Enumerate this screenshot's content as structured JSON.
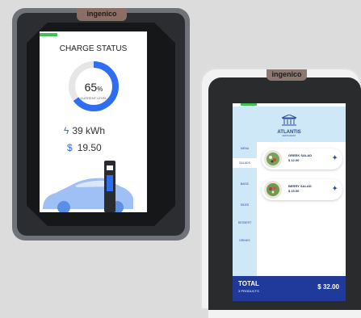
{
  "device1": {
    "brand": "ingenico",
    "screen": {
      "title": "CHARGE STATUS",
      "percent_value": "65",
      "percent_sign": "%",
      "percent_caption": "CURRENT LEVEL",
      "charge_level": 0.65,
      "energy": "39 kWh",
      "cost_symbol": "$",
      "cost": "19.50",
      "accent_color": "#2d6ff0"
    }
  },
  "device2": {
    "brand": "ingenico",
    "screen": {
      "logo_name": "ATLANTIS",
      "logo_sub": "RESTAURANT",
      "menu": [
        "MENU",
        "SALADS",
        "BASIC",
        "SIDES",
        "DESSERT",
        "DRINKS"
      ],
      "active_item": "SALADS",
      "products": [
        {
          "name": "GREEK SALAD",
          "price": "$ 12.00"
        },
        {
          "name": "BERRY SALAD",
          "price": "$ 15.00"
        }
      ],
      "total_label": "TOTAL",
      "total_count": "3 PRODUCTS",
      "total_value": "$ 32.00",
      "header_color": "#cfe8f7",
      "footer_color": "#1f3a9a"
    }
  }
}
